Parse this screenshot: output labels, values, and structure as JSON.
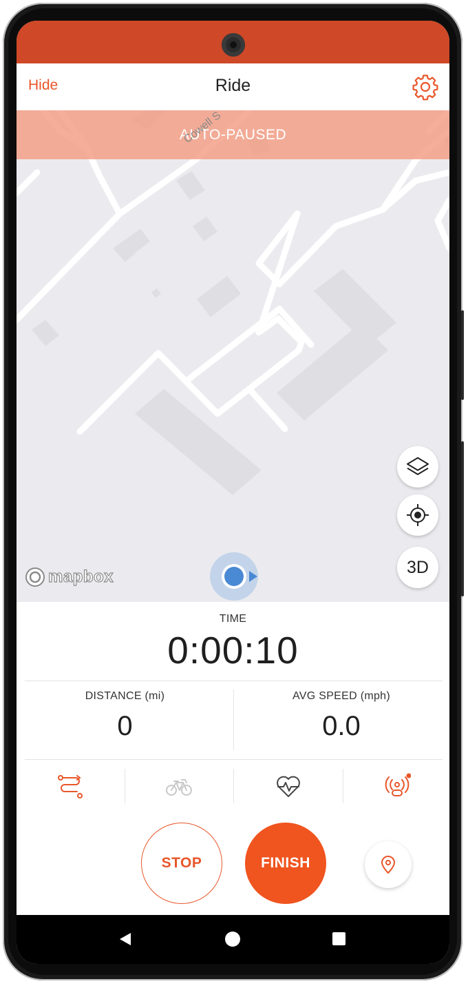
{
  "header": {
    "hide_label": "Hide",
    "title": "Ride",
    "settings_icon": "gear-icon"
  },
  "map": {
    "banner_text": "AUTO-PAUSED",
    "street_label": "Cowell S",
    "attribution": "mapbox",
    "layers_icon": "layers-icon",
    "recenter_icon": "crosshair-icon",
    "view_3d_label": "3D"
  },
  "stats": {
    "time_label": "TIME",
    "time_value": "0:00:10",
    "distance_label": "DISTANCE  (mi)",
    "distance_value": "0",
    "speed_label": "AVG SPEED  (mph)",
    "speed_value": "0.0"
  },
  "tabs": [
    {
      "icon": "route-icon",
      "active": true
    },
    {
      "icon": "bike-icon",
      "active": false
    },
    {
      "icon": "heart-rate-icon",
      "active": false
    },
    {
      "icon": "beacon-icon",
      "active": true,
      "notification": true
    }
  ],
  "actions": {
    "stop_label": "STOP",
    "finish_label": "FINISH",
    "pin_icon": "map-pin-icon"
  },
  "colors": {
    "accent": "#f0541f",
    "status_bar": "#cf4827",
    "banner": "#f39c82",
    "location": "#4a89d4"
  }
}
